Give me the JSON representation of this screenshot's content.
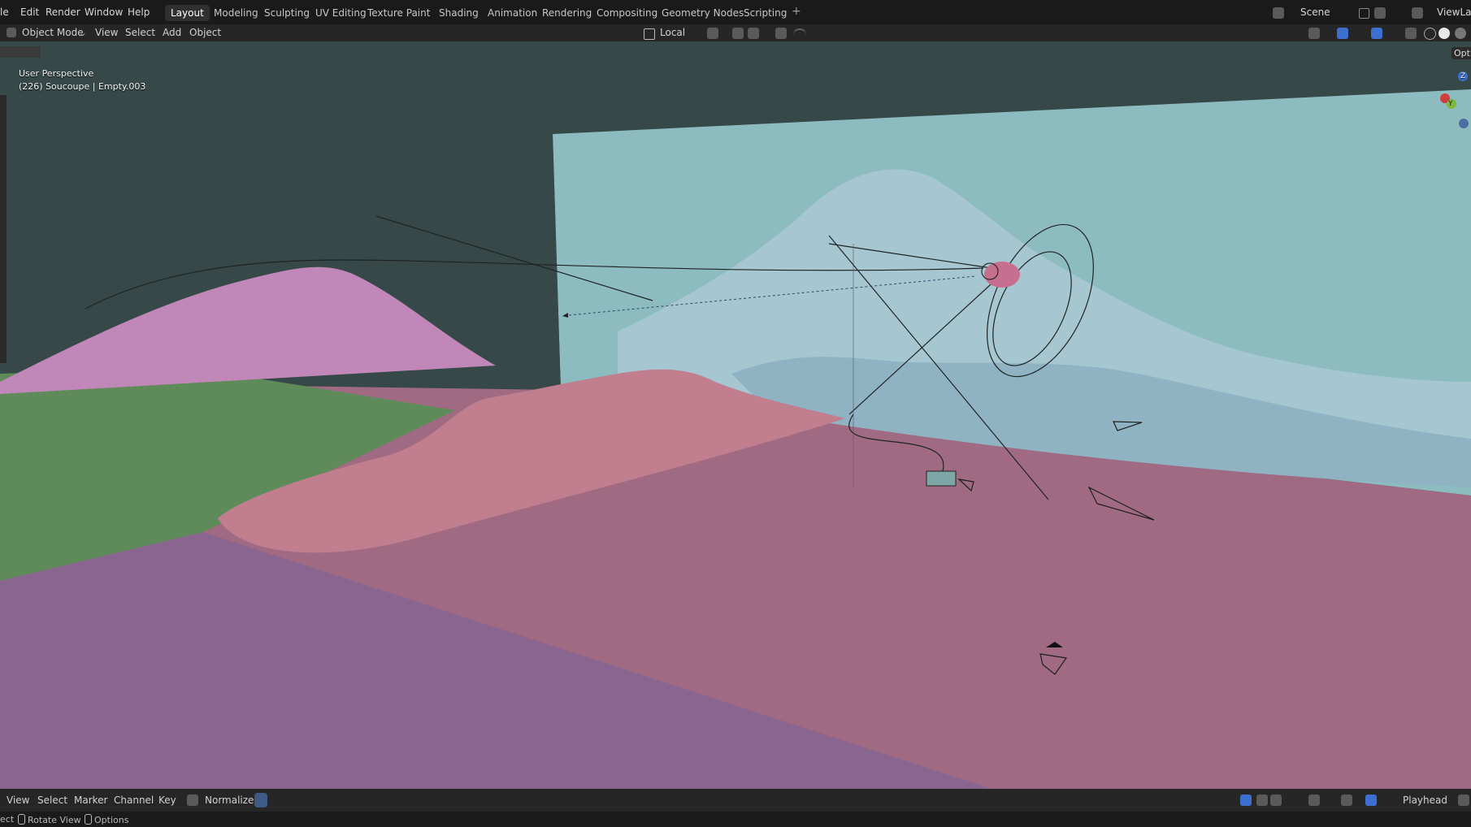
{
  "menu": {
    "file": "le",
    "edit": "Edit",
    "render": "Render",
    "window": "Window",
    "help": "Help"
  },
  "workspaces": [
    "Layout",
    "Modeling",
    "Sculpting",
    "UV Editing",
    "Texture Paint",
    "Shading",
    "Animation",
    "Rendering",
    "Compositing",
    "Geometry Nodes",
    "Scripting"
  ],
  "workspace_add": "+",
  "scene": {
    "name": "Scene",
    "view_layer": "ViewLay"
  },
  "header": {
    "mode": "Object Mode",
    "view": "View",
    "select": "Select",
    "add": "Add",
    "object": "Object",
    "orientation": "Local",
    "options": "Opti"
  },
  "viewport": {
    "perspective": "User Perspective",
    "object_info": "(226) Soucoupe | Empty.003",
    "gizmo": {
      "z": "Z",
      "y": "Y"
    }
  },
  "timeline": {
    "view": "View",
    "select": "Select",
    "marker": "Marker",
    "channel": "Channel",
    "key": "Key",
    "normalize": "Normalize",
    "playhead": "Playhead"
  },
  "status": {
    "select": "ect",
    "rotate": "Rotate View",
    "options": "Options"
  },
  "colors": {
    "sky_back": "#8cbbc0",
    "wall_left": "#364848",
    "floor_pink": "#a06a83",
    "floor_purple": "#8a658f",
    "floor_green": "#5f8b5b",
    "mountain_pink": "#c087b8",
    "ridge_pink": "#c07e8f",
    "mountain_blue": "#a6c7d2",
    "accent": "#3d6fd1"
  }
}
